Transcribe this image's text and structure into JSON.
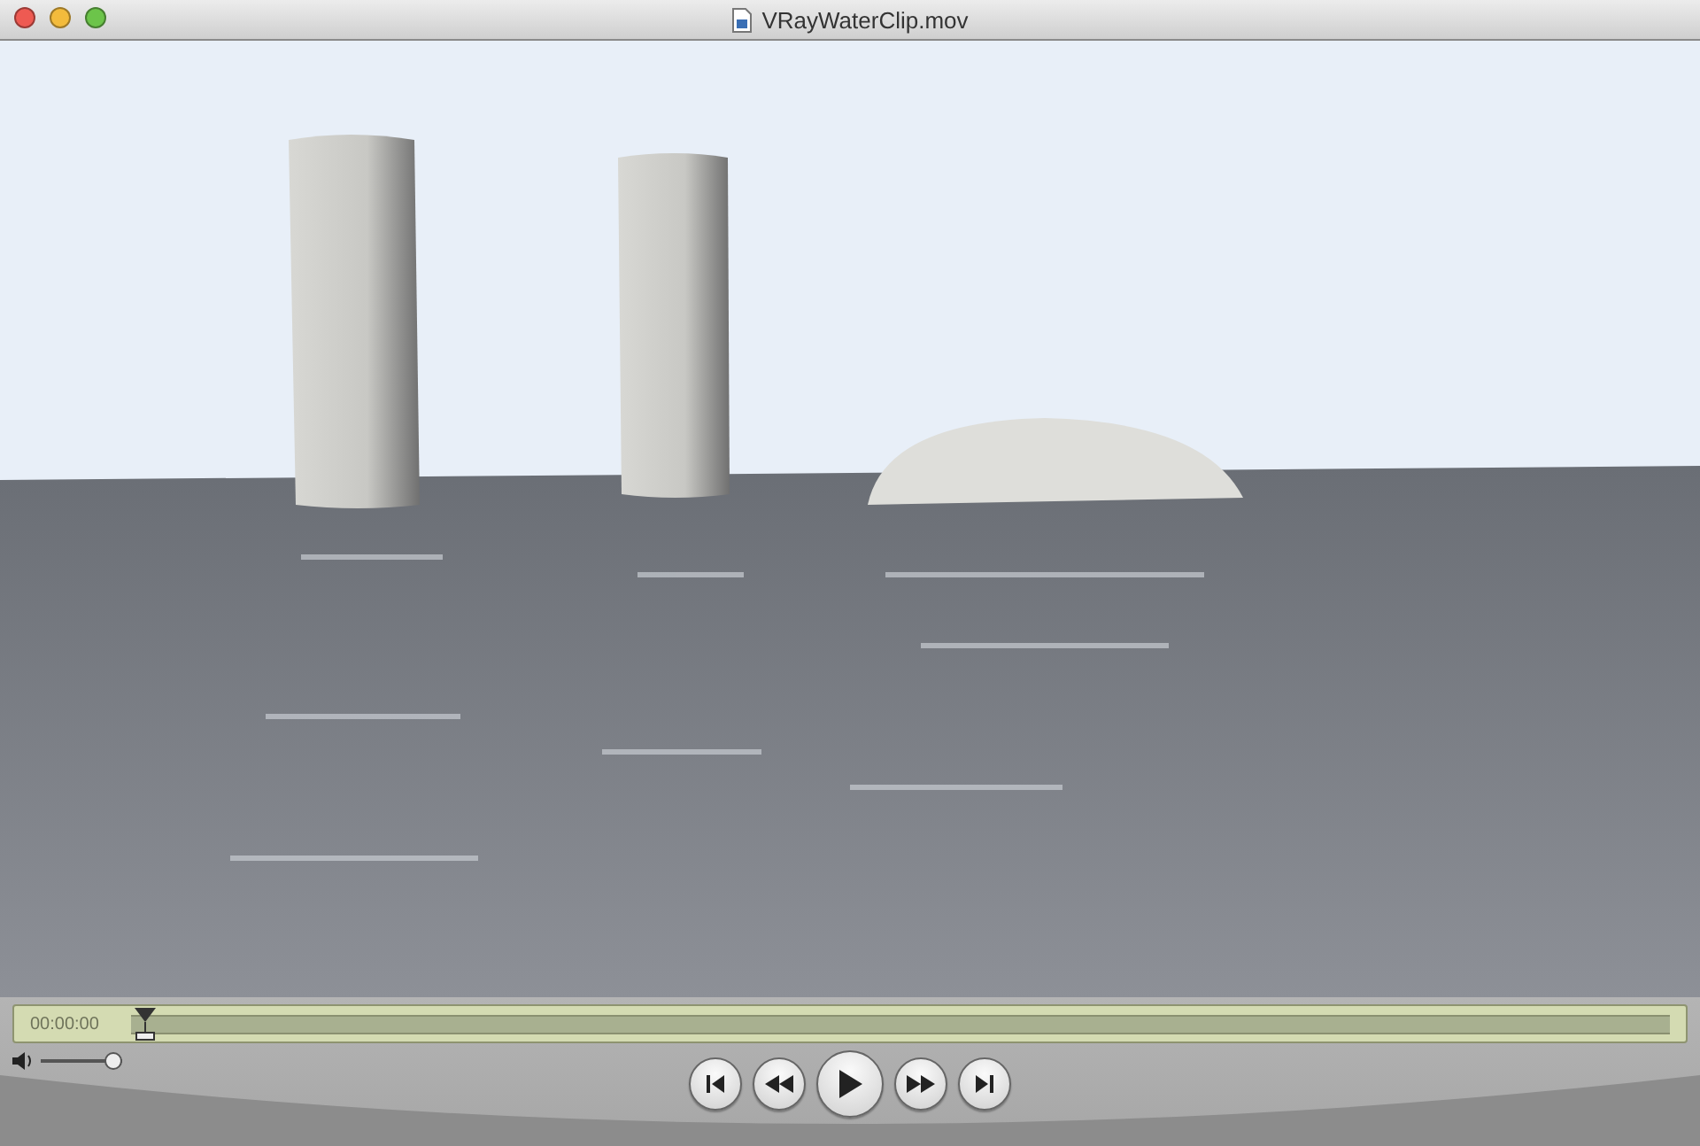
{
  "window": {
    "title": "VRayWaterClip.mov"
  },
  "timeline": {
    "time": "00:00:00",
    "level": 0
  },
  "volume": {
    "level": 1
  },
  "transport": [
    {
      "kind": "start"
    },
    {
      "kind": "rewind"
    },
    {
      "kind": "play"
    },
    {
      "kind": "forward"
    },
    {
      "kind": "end"
    }
  ]
}
